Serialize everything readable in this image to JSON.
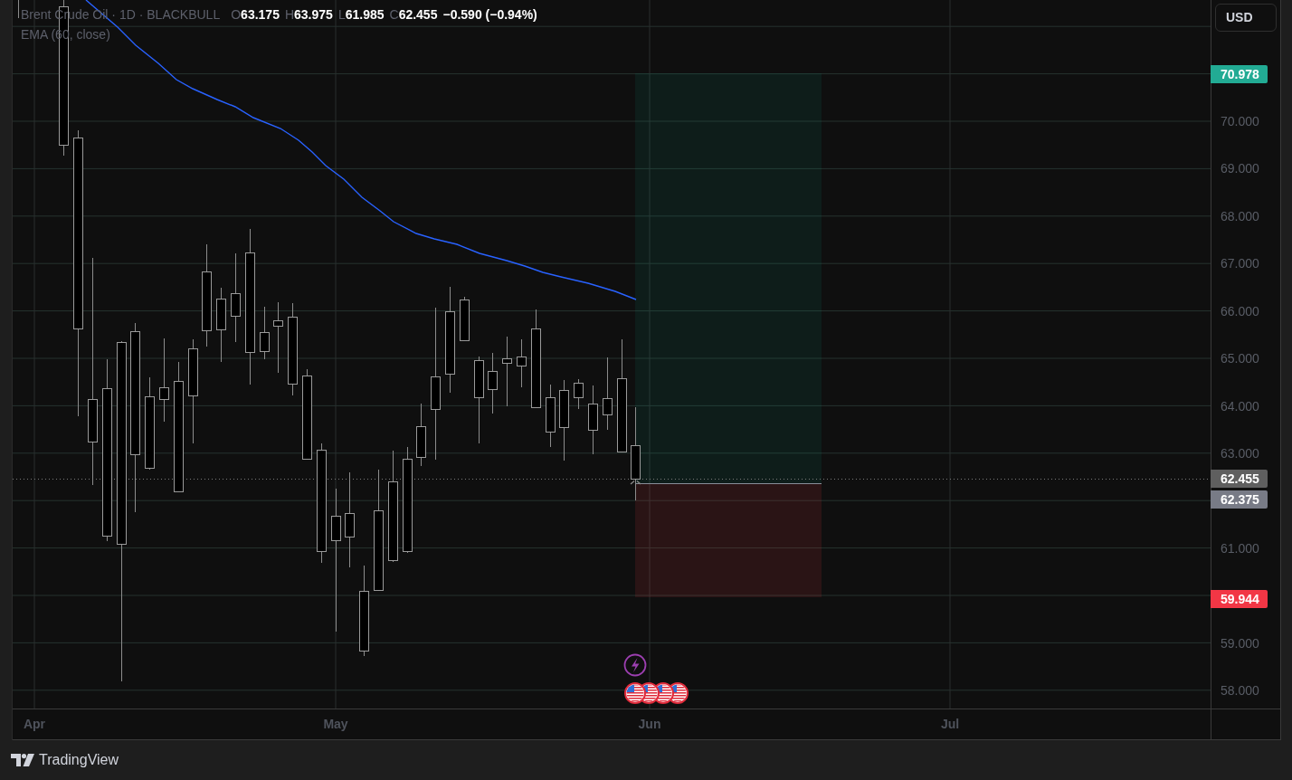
{
  "legend": {
    "symbol": "Brent Crude Oil · 1D · BLACKBULL",
    "ohlc": [
      {
        "label": "O",
        "value": "63.175"
      },
      {
        "label": "H",
        "value": "63.975"
      },
      {
        "label": "L",
        "value": "61.985"
      },
      {
        "label": "C",
        "value": "62.455"
      }
    ],
    "change": "−0.590 (−0.94%)",
    "indicator": "EMA (60, close)"
  },
  "price_scale": {
    "currency": "USD",
    "ticks": [
      "70.000",
      "69.000",
      "68.000",
      "67.000",
      "66.000",
      "65.000",
      "64.000",
      "63.000",
      "61.000",
      "59.000",
      "58.000"
    ],
    "markers": [
      {
        "kind": "target",
        "label": "70.978",
        "color": "#22ab94"
      },
      {
        "kind": "last",
        "label": "62.455",
        "color": "#5f5f5f"
      },
      {
        "kind": "entry",
        "label": "62.375",
        "color": "#787b86"
      },
      {
        "kind": "stop",
        "label": "59.944",
        "color": "#f23645"
      }
    ]
  },
  "time_scale": {
    "labels": [
      "Apr",
      "May",
      "Jun",
      "Jul"
    ]
  },
  "footer": {
    "brand": "TradingView"
  }
}
